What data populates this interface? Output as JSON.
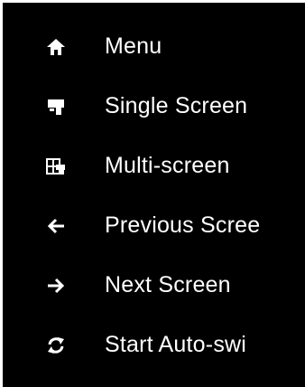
{
  "menu": {
    "items": [
      {
        "label": "Menu",
        "icon": "home-icon"
      },
      {
        "label": "Single Screen",
        "icon": "single-screen-icon"
      },
      {
        "label": "Multi-screen",
        "icon": "multi-screen-icon"
      },
      {
        "label": "Previous Scree",
        "icon": "arrow-left-icon"
      },
      {
        "label": "Next Screen",
        "icon": "arrow-right-icon"
      },
      {
        "label": "Start Auto-swi",
        "icon": "refresh-icon"
      }
    ],
    "colors": {
      "background": "#000000",
      "text": "#ffffff",
      "frame": "#ffffff"
    }
  }
}
